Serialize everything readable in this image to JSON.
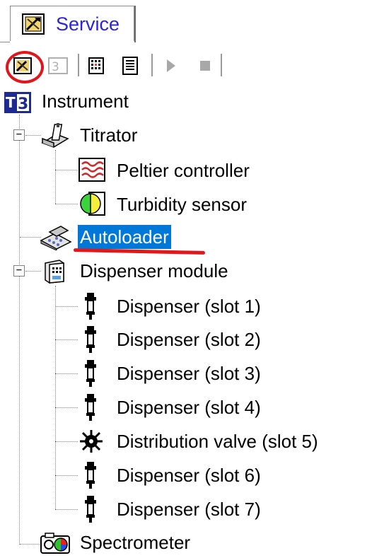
{
  "tab": {
    "label": "Service",
    "icon": "service-tool-icon"
  },
  "toolbar": {
    "buttons": [
      {
        "name": "service-tool-button",
        "icon": "service-tool-icon",
        "state": "active"
      },
      {
        "name": "t3-button",
        "icon": "t3-icon",
        "state": "disabled"
      },
      {
        "name": "grid-view-button",
        "icon": "grid-icon",
        "state": "enabled"
      },
      {
        "name": "list-view-button",
        "icon": "list-icon",
        "state": "enabled"
      },
      {
        "name": "play-button",
        "icon": "play-icon",
        "state": "disabled"
      },
      {
        "name": "stop-button",
        "icon": "stop-icon",
        "state": "disabled"
      }
    ]
  },
  "tree": {
    "root": {
      "label": "Instrument",
      "icon": "t3-instrument-icon"
    },
    "titrator": {
      "label": "Titrator",
      "icon": "titrator-icon",
      "expanded": true
    },
    "peltier": {
      "label": "Peltier controller",
      "icon": "peltier-icon"
    },
    "turbidity": {
      "label": "Turbidity sensor",
      "icon": "turbidity-sensor-icon"
    },
    "autoloader": {
      "label": "Autoloader",
      "icon": "autoloader-icon",
      "selected": true
    },
    "dispenser_module": {
      "label": "Dispenser module",
      "icon": "dispenser-module-icon",
      "expanded": true
    },
    "slots": [
      {
        "label": "Dispenser (slot 1)",
        "icon": "dispenser-icon"
      },
      {
        "label": "Dispenser (slot 2)",
        "icon": "dispenser-icon"
      },
      {
        "label": "Dispenser (slot 3)",
        "icon": "dispenser-icon"
      },
      {
        "label": "Dispenser (slot 4)",
        "icon": "dispenser-icon"
      },
      {
        "label": "Distribution valve (slot 5)",
        "icon": "distribution-valve-icon"
      },
      {
        "label": "Dispenser (slot 6)",
        "icon": "dispenser-icon"
      },
      {
        "label": "Dispenser (slot 7)",
        "icon": "dispenser-icon"
      }
    ],
    "spectrometer": {
      "label": "Spectrometer",
      "icon": "spectrometer-icon"
    }
  },
  "colors": {
    "selection": "#0078d7",
    "tab_text": "#2a26d8",
    "annotation_red": "#e0161a"
  }
}
